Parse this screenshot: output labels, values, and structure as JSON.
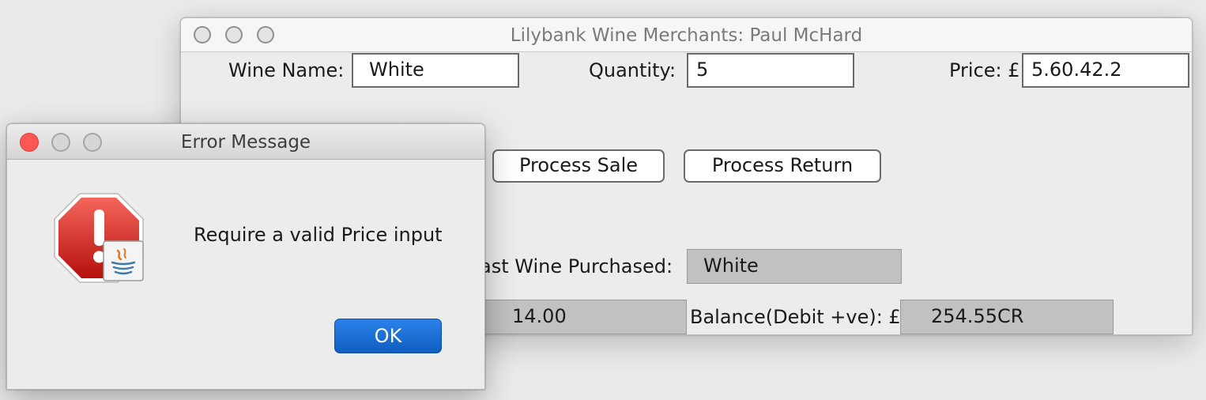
{
  "main_window": {
    "title": "Lilybank Wine Merchants: Paul McHard",
    "wine_name_label": "Wine Name:",
    "wine_name_value": "White",
    "quantity_label": "Quantity:",
    "quantity_value": "5",
    "price_label": "Price: £",
    "price_value": "5.60.42.2",
    "process_sale_label": "Process Sale",
    "process_return_label": "Process Return",
    "last_wine_label": "ast Wine Purchased:",
    "last_wine_value": "White",
    "amount_value": "14.00",
    "balance_label": "Balance(Debit +ve): £",
    "balance_value": "254.55CR"
  },
  "dialog": {
    "title": "Error Message",
    "message": "Require a valid Price input",
    "ok_label": "OK",
    "icon": "error-stop-icon"
  }
}
